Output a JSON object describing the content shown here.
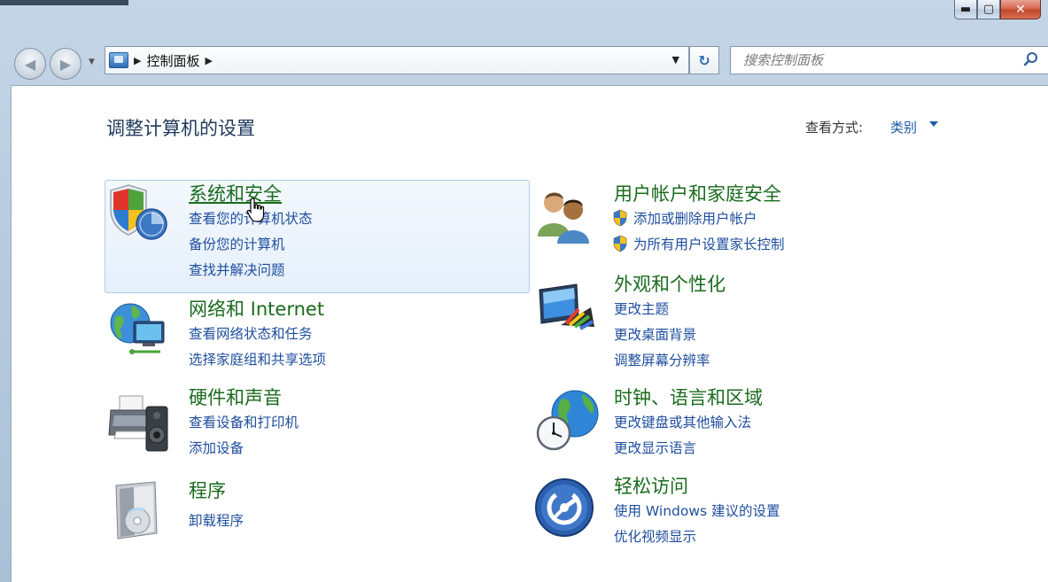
{
  "window": {
    "controls": {
      "minimize": "▬",
      "maximize": "▢",
      "close": "✕"
    }
  },
  "nav": {
    "back": "◀",
    "forward": "▶",
    "breadcrumb_separator": "▶",
    "breadcrumb": [
      "控制面板"
    ],
    "dropdown": "▼",
    "refresh": "↻"
  },
  "search": {
    "placeholder": "搜索控制面板"
  },
  "page": {
    "title": "调整计算机的设置",
    "view_by_label": "查看方式:",
    "view_by_value": "类别"
  },
  "categories": [
    {
      "icon": "shield-security-icon",
      "heading": "系统和安全",
      "links": [
        "查看您的计算机状态",
        "备份您的计算机",
        "查找并解决问题"
      ]
    },
    {
      "icon": "users-icon",
      "heading": "用户帐户和家庭安全",
      "links": [
        "添加或删除用户帐户",
        "为所有用户设置家长控制"
      ]
    },
    {
      "icon": "network-globe-icon",
      "heading": "网络和 Internet",
      "links": [
        "查看网络状态和任务",
        "选择家庭组和共享选项"
      ]
    },
    {
      "icon": "monitor-palette-icon",
      "heading": "外观和个性化",
      "links": [
        "更改主题",
        "更改桌面背景",
        "调整屏幕分辨率"
      ]
    },
    {
      "icon": "printer-speaker-icon",
      "heading": "硬件和声音",
      "links": [
        "查看设备和打印机",
        "添加设备"
      ]
    },
    {
      "icon": "clock-globe-icon",
      "heading": "时钟、语言和区域",
      "links": [
        "更改键盘或其他输入法",
        "更改显示语言"
      ]
    },
    {
      "icon": "programs-box-icon",
      "heading": "程序",
      "links": [
        "卸载程序"
      ]
    },
    {
      "icon": "ease-of-access-icon",
      "heading": "轻松访问",
      "links": [
        "使用 Windows 建议的设置",
        "优化视频显示"
      ]
    }
  ],
  "colors": {
    "heading_green": "#1a6b1d",
    "link_blue": "#1f4e9e",
    "title_blue": "#1e395b"
  }
}
